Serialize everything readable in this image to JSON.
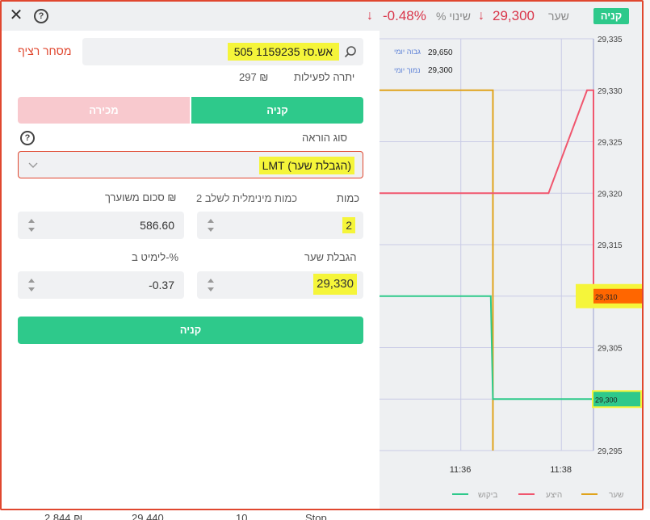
{
  "topbar": {
    "buy_badge": "קניה",
    "rate_label": "שער",
    "rate_value": "29,300",
    "change_label": "% שינוי",
    "change_value": "-0.48%",
    "arrow": "↓"
  },
  "form": {
    "search_value": "אש.סז 1159235 505",
    "continuous_trading": "מסחר רציף",
    "balance_label": "יתרה לפעילות",
    "balance_value": "297 ₪",
    "sell_tab": "מכירה",
    "buy_tab": "קניה",
    "order_type_label": "סוג הוראה",
    "order_type_value": "LMT (הגבלת שער)",
    "qty_label": "כמות",
    "min_qty_label": "כמות מינימלית לשלב 2",
    "amount_label": "סכום משוערך ₪",
    "qty_value": "2",
    "amount_value": "586.60",
    "price_limit_label": "הגבלת שער",
    "limit_pct_label": "לימיט ב-%",
    "price_limit_value": "29,330",
    "limit_pct_value": "-0.37",
    "submit_label": "קניה"
  },
  "background": {
    "c1": "2,844 ₪",
    "c2": "29,440",
    "c3": "10",
    "c4": "Stop"
  },
  "chart_data": {
    "type": "line",
    "y_ticks": [
      "29,335",
      "29,330",
      "29,325",
      "29,320",
      "29,315",
      "29,310",
      "29,305",
      "29,300",
      "29,295"
    ],
    "x_ticks": [
      "11:36",
      "11:38"
    ],
    "ylim": [
      29295,
      29335
    ],
    "daily_high_label": "גבוה יומי",
    "daily_high_value": "29,650",
    "daily_low_label": "נמוך יומי",
    "daily_low_value": "29,300",
    "current_ask_label": "29,310",
    "current_bid_label": "29,300",
    "series": [
      {
        "name": "שער",
        "color": "#e0a31c",
        "points": [
          [
            0,
            29330
          ],
          [
            0.53,
            29330
          ],
          [
            0.53,
            29295
          ]
        ]
      },
      {
        "name": "היצע",
        "color": "#f0566e",
        "points": [
          [
            0,
            29320
          ],
          [
            0.79,
            29320
          ],
          [
            0.97,
            29330
          ],
          [
            1,
            29330
          ],
          [
            1,
            29310
          ]
        ]
      },
      {
        "name": "ביקוש",
        "color": "#2ec98b",
        "points": [
          [
            0,
            29310
          ],
          [
            0.52,
            29310
          ],
          [
            0.53,
            29300
          ],
          [
            1,
            29300
          ]
        ]
      }
    ],
    "grid": true,
    "legend": "bottom"
  }
}
